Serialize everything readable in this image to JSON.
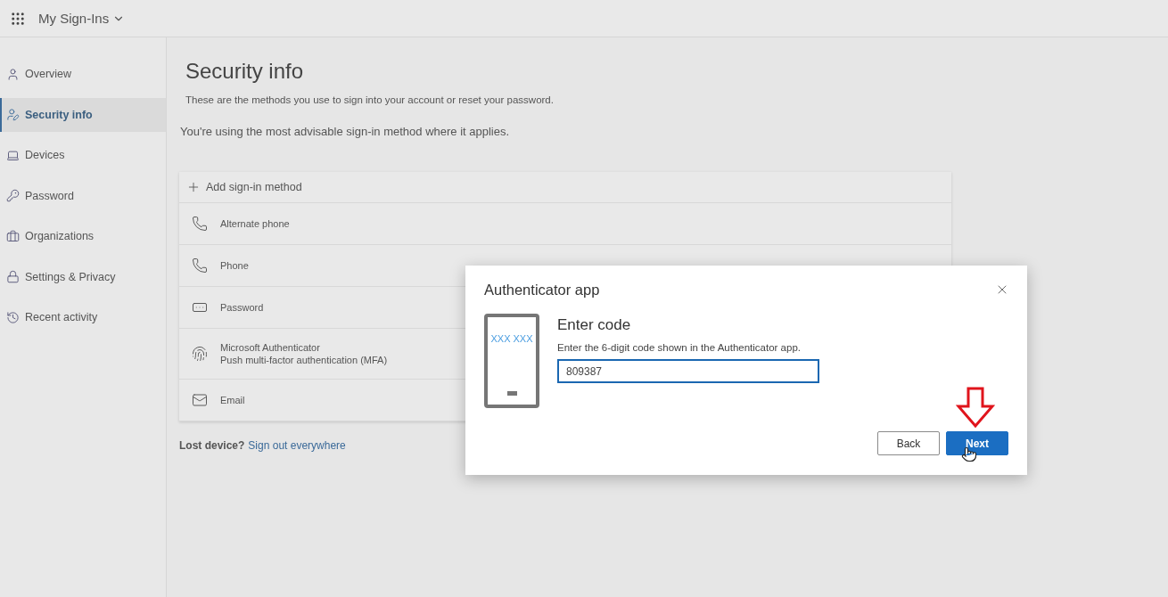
{
  "app": {
    "title": "My Sign-Ins"
  },
  "sidebar": {
    "items": [
      {
        "kind": "overview",
        "label": "Overview",
        "selected": false
      },
      {
        "kind": "security",
        "label": "Security info",
        "selected": true
      },
      {
        "kind": "devices",
        "label": "Devices",
        "selected": false
      },
      {
        "kind": "password",
        "label": "Password",
        "selected": false
      },
      {
        "kind": "organizations",
        "label": "Organizations",
        "selected": false
      },
      {
        "kind": "privacy",
        "label": "Settings & Privacy",
        "selected": false
      },
      {
        "kind": "activity",
        "label": "Recent activity",
        "selected": false
      }
    ]
  },
  "page": {
    "title": "Security info",
    "subtitle": "These are the methods you use to sign into your account or reset your password.",
    "notice": "You're using the most advisable sign-in method where it applies."
  },
  "methods": {
    "add_label": "Add sign-in method",
    "rows": [
      {
        "kind": "phone",
        "name": "Alternate phone"
      },
      {
        "kind": "phone",
        "name": "Phone"
      },
      {
        "kind": "password",
        "name": "Password"
      },
      {
        "kind": "authenticator",
        "name": "Microsoft Authenticator",
        "detail": "Push multi-factor authentication (MFA)"
      },
      {
        "kind": "email",
        "name": "Email"
      }
    ]
  },
  "lost_device": {
    "label": "Lost device?",
    "link": "Sign out everywhere"
  },
  "dialog": {
    "title": "Authenticator app",
    "phone_code": "XXX XXX",
    "heading": "Enter code",
    "instruction": "Enter the 6-digit code shown in the Authenticator app.",
    "code": "809387",
    "buttons": [
      {
        "kind": "secondary",
        "label": "Back"
      },
      {
        "kind": "primary",
        "label": "Next"
      }
    ]
  }
}
